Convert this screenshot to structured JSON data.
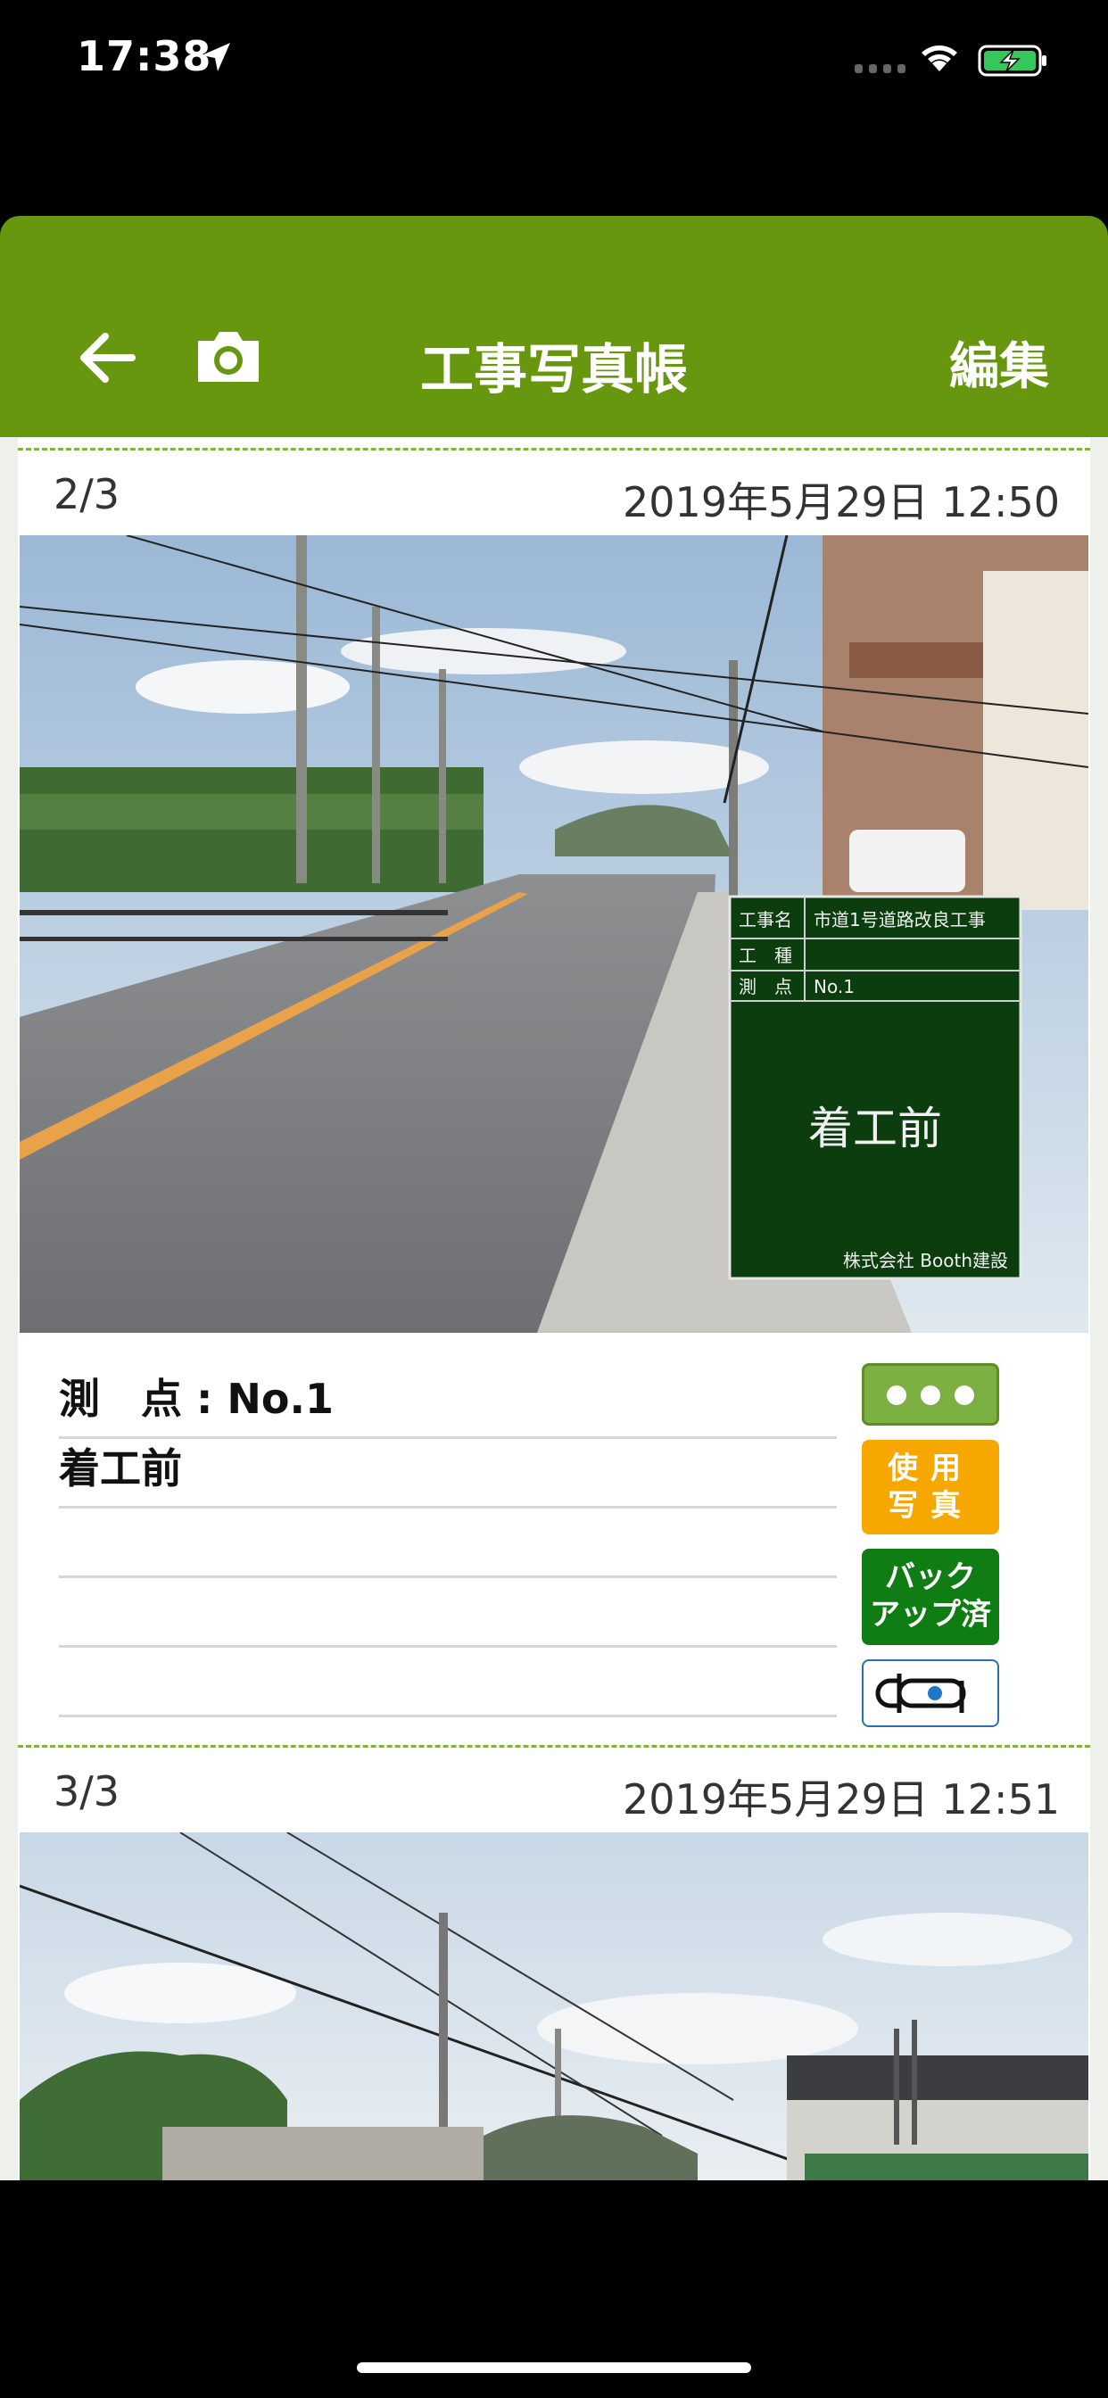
{
  "status_bar": {
    "time": "17:38"
  },
  "header": {
    "title": "工事写真帳",
    "edit_label": "編集"
  },
  "photos": [
    {
      "index": "2/3",
      "datetime": "2019年5月29日 12:50",
      "board": {
        "label_name": "工事名",
        "project_name": "市道1号道路改良工事",
        "label_type": "工　種",
        "label_point": "測　点",
        "point": "No.1",
        "title": "着工前",
        "company": "株式会社 Booth建設"
      },
      "memo": [
        "測　点 : No.1",
        "着工前",
        "",
        "",
        ""
      ],
      "buttons": {
        "use_photo": "使 用 写 真",
        "use_line1": "使用",
        "use_line2": "写真",
        "backup_line1": "バック",
        "backup_line2": "アップ済"
      }
    },
    {
      "index": "3/3",
      "datetime": "2019年5月29日 12:51"
    }
  ]
}
